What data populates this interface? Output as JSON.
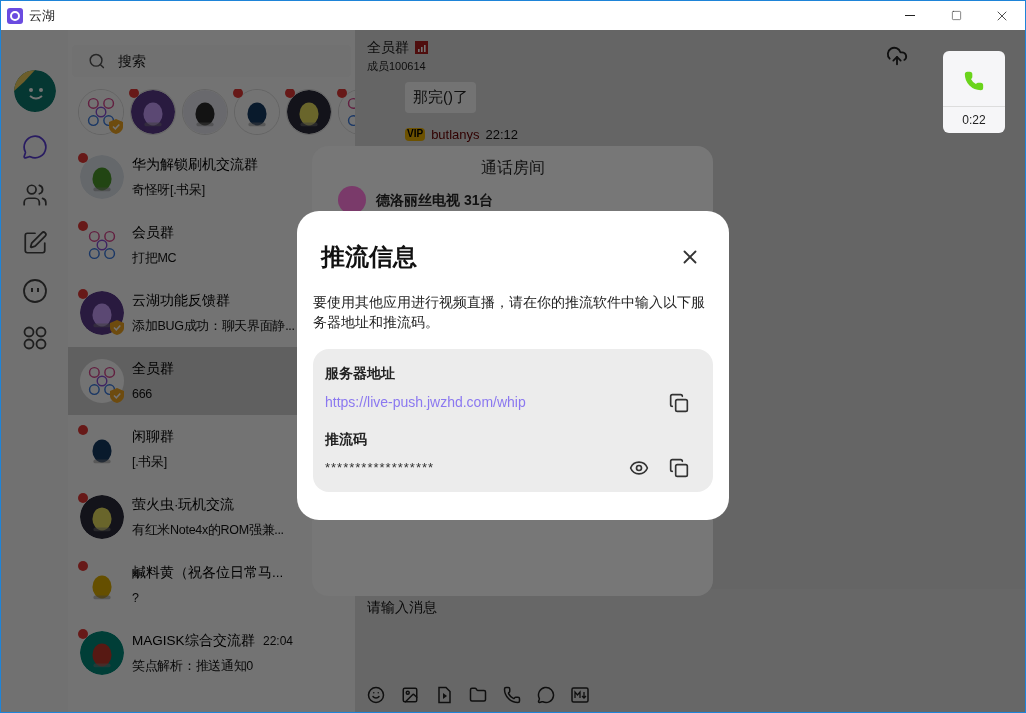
{
  "window": {
    "title": "云湖"
  },
  "rail": [
    {
      "kind": "profile",
      "selected": false
    },
    {
      "kind": "chat",
      "selected": true
    },
    {
      "kind": "contacts",
      "selected": false
    },
    {
      "kind": "notes",
      "selected": false
    },
    {
      "kind": "face",
      "selected": false
    },
    {
      "kind": "apps",
      "selected": false
    }
  ],
  "search": {
    "placeholder": "搜索"
  },
  "stories": [
    {
      "kind": "group",
      "unread": false,
      "verified": true
    },
    {
      "kind": "picture",
      "unread": true,
      "verified": false
    },
    {
      "kind": "picture",
      "unread": false,
      "verified": false
    },
    {
      "kind": "picture",
      "unread": true,
      "verified": false
    },
    {
      "kind": "picture",
      "unread": true,
      "verified": false
    },
    {
      "kind": "group",
      "unread": true,
      "verified": false
    }
  ],
  "chats": [
    {
      "name": "华为解锁刷机交流群",
      "preview": "奇怪呀[.书呆]",
      "kind": "picture",
      "unread": true,
      "verified": false,
      "selected": false
    },
    {
      "name": "会员群",
      "preview": "打把MC",
      "kind": "group",
      "unread": true,
      "verified": false,
      "selected": false
    },
    {
      "name": "云湖功能反馈群",
      "preview": "添加BUG成功：聊天界面静...",
      "kind": "picture",
      "unread": true,
      "verified": true,
      "selected": false
    },
    {
      "name": "全员群",
      "preview": "666",
      "kind": "group",
      "unread": false,
      "verified": true,
      "selected": true
    },
    {
      "name": "闲聊群",
      "preview": "[.书呆]",
      "kind": "picture",
      "unread": true,
      "verified": false,
      "selected": false
    },
    {
      "name": "萤火虫·玩机交流",
      "preview": "有红米Note4x的ROM强兼...",
      "kind": "picture",
      "unread": true,
      "verified": false,
      "selected": false
    },
    {
      "name": "鹹料黄（祝各位日常马...",
      "preview": "?",
      "kind": "picture",
      "unread": true,
      "verified": false,
      "selected": false
    },
    {
      "name": "MAGISK综合交流群",
      "preview": "笑点解析：推送通知0",
      "time": "22:04",
      "kind": "picture",
      "unread": true,
      "verified": false,
      "selected": false
    }
  ],
  "chat": {
    "name": "全员群",
    "members": "成员100614",
    "messages": [
      {
        "kind": "bubble",
        "text": "那完()了"
      },
      {
        "kind": "sender",
        "badge": "VIP",
        "sender": "butlanys",
        "time": "22:12"
      }
    ]
  },
  "composer": {
    "placeholder": "请输入消息"
  },
  "call_room": {
    "title": "通话房间",
    "item": "德洛丽丝电视 31台"
  },
  "stream_dialog": {
    "title": "推流信息",
    "description": "要使用其他应用进行视频直播，请在你的推流软件中输入以下服务器地址和推流码。",
    "fields": [
      {
        "label": "服务器地址",
        "value": "https://live-push.jwzhd.com/whip",
        "kind": "link"
      },
      {
        "label": "推流码",
        "value": "******************",
        "kind": "secret"
      }
    ]
  },
  "call_widget": {
    "time": "0:22"
  }
}
